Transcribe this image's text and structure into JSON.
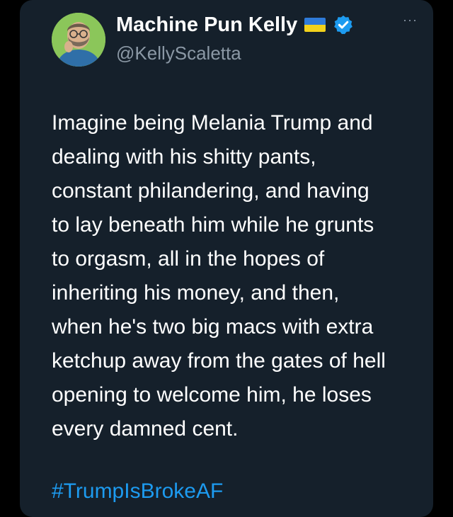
{
  "author": {
    "display_name": "Machine Pun Kelly",
    "handle": "@KellyScaletta",
    "avatar_icon": "bearded-man-avatar-icon",
    "flag_icon": "ukraine-flag-icon",
    "verified_icon": "verified-badge-icon"
  },
  "menu": {
    "more_label": "···"
  },
  "tweet": {
    "lines": [
      "Imagine being Melania Trump and",
      "dealing with his shitty pants,",
      "constant philandering, and having",
      "to lay beneath him while he grunts",
      "to orgasm, all in the hopes of",
      "inheriting his money, and then,",
      "when he's two big macs with extra",
      "ketchup away from the gates of hell",
      "opening to welcome him, he loses",
      "every damned cent."
    ],
    "hashtag": "#TrumpIsBrokeAF"
  },
  "colors": {
    "background": "#000000",
    "card": "#15202b",
    "text": "#ffffff",
    "secondary": "#8b98a5",
    "link": "#1d9bf0",
    "verified": "#1d9bf0",
    "avatar_bg": "#8bc65a"
  }
}
